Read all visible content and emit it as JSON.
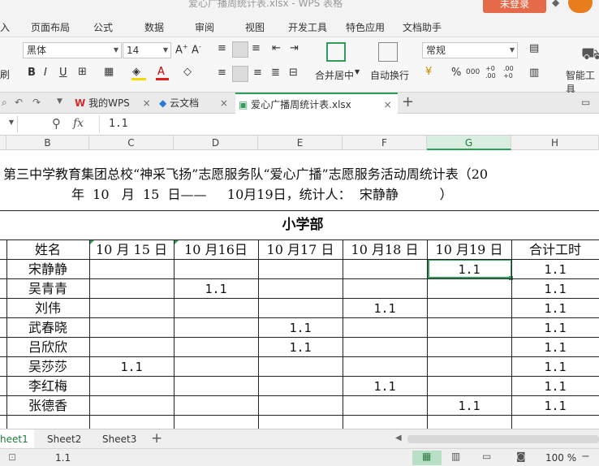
{
  "window": {
    "title": "爱心广播周统计表.xlsx - WPS 表格",
    "login_label": "未登录"
  },
  "menu": {
    "items": [
      "入",
      "页面布局",
      "公式",
      "数据",
      "审阅",
      "视图",
      "开发工具",
      "特色应用",
      "文档助手"
    ]
  },
  "ribbon": {
    "font_name": "黑体",
    "font_size": "14",
    "merge_label": "合并居中",
    "wrap_label": "自动换行",
    "number_format": "常规",
    "smart_label": "智能工具",
    "brush_label": "刷",
    "percent": "%",
    "comma": "000",
    "dec_up": "+0 .00",
    "dec_down": ".00 +0",
    "text_color": "#e02020",
    "fill_color": "#f5d800",
    "accent": "#2e9e5a"
  },
  "tabs": {
    "wps_label": "我的WPS",
    "cloud_label": "云文档",
    "file_label": "爱心广播周统计表.xlsx",
    "add_label": "+"
  },
  "formula": {
    "fx_label": "fx",
    "value": "1.1"
  },
  "columns": [
    "B",
    "C",
    "D",
    "E",
    "F",
    "G",
    "H"
  ],
  "sheet": {
    "title_line1": "第三中学教育集团总校“神采飞扬”志愿服务队“爱心广播”志愿服务活动周统计表（20",
    "title_line2": "年  10   月  15  日——     10月19日，统计人：  宋静静          ）",
    "section": "小学部",
    "headers": [
      "姓名",
      "10 月 15 日",
      "10 月16日",
      "10 月17 日",
      "10 月18 日",
      "10 月19 日",
      "合计工时"
    ],
    "rows": [
      {
        "name": "宋静静",
        "cells": [
          "",
          "",
          "",
          "",
          "1.1"
        ],
        "total": "1.1"
      },
      {
        "name": "吴青青",
        "cells": [
          "",
          "1.1",
          "",
          "",
          ""
        ],
        "total": "1.1"
      },
      {
        "name": "刘伟",
        "cells": [
          "",
          "",
          "",
          "1.1",
          ""
        ],
        "total": "1.1"
      },
      {
        "name": "武春晓",
        "cells": [
          "",
          "",
          "1.1",
          "",
          ""
        ],
        "total": "1.1"
      },
      {
        "name": "吕欣欣",
        "cells": [
          "",
          "",
          "1.1",
          "",
          ""
        ],
        "total": "1.1"
      },
      {
        "name": "吴莎莎",
        "cells": [
          "1.1",
          "",
          "",
          "",
          ""
        ],
        "total": "1.1"
      },
      {
        "name": "李红梅",
        "cells": [
          "",
          "",
          "",
          "1.1",
          ""
        ],
        "total": "1.1"
      },
      {
        "name": "张德香",
        "cells": [
          "",
          "",
          "",
          "",
          "1.1"
        ],
        "total": "1.1"
      }
    ]
  },
  "sheet_tabs": [
    "heet1",
    "Sheet2",
    "Sheet3"
  ],
  "status": {
    "cell_value": "1.1",
    "zoom": "100 %",
    "minus": "−"
  }
}
